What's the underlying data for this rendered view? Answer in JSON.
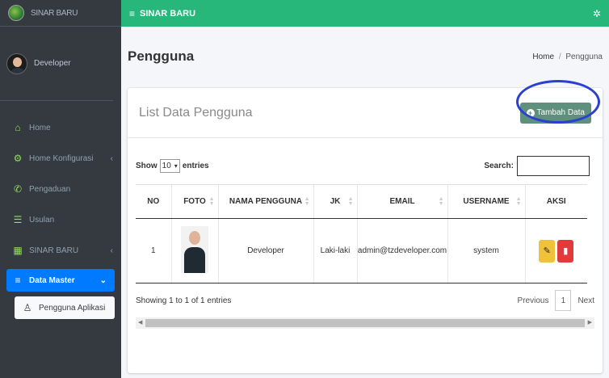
{
  "brand": {
    "name": "SINAR BARU"
  },
  "user": {
    "name": "Developer"
  },
  "sidebar": {
    "items": [
      {
        "label": "Home",
        "icon": "home-icon"
      },
      {
        "label": "Home Konfigurasi",
        "icon": "cogs-icon"
      },
      {
        "label": "Pengaduan",
        "icon": "phone-icon"
      },
      {
        "label": "Usulan",
        "icon": "list-icon"
      },
      {
        "label": "SINAR BARU",
        "icon": "building-icon"
      },
      {
        "label": "Data Master",
        "icon": "database-icon"
      },
      {
        "label": "Pengguna Aplikasi",
        "icon": "user-icon"
      }
    ]
  },
  "topbar": {
    "title": "SINAR BARU"
  },
  "header": {
    "title": "Pengguna",
    "breadcrumb": {
      "home": "Home",
      "sep": "/",
      "current": "Pengguna"
    }
  },
  "card": {
    "title": "List Data Pengguna",
    "add_label": "Tambah Data",
    "show_label": "Show",
    "entries_label": "entries",
    "page_size": "10",
    "search_label": "Search:"
  },
  "table": {
    "columns": [
      "NO",
      "FOTO",
      "NAMA PENGGUNA",
      "JK",
      "EMAIL",
      "USERNAME",
      "AKSI"
    ],
    "rows": [
      {
        "no": "1",
        "nama": "Developer",
        "jk": "Laki-laki",
        "email": "admin@tzdeveloper.com",
        "username": "system"
      }
    ]
  },
  "footer": {
    "info": "Showing 1 to 1 of 1 entries",
    "previous": "Previous",
    "page": "1",
    "next": "Next"
  },
  "colors": {
    "topbar": "#28b77a",
    "sidebar": "#343a40",
    "active": "#007bff",
    "add_button": "#5f8f7d",
    "edit": "#f0c23b",
    "delete": "#e23a3a"
  }
}
